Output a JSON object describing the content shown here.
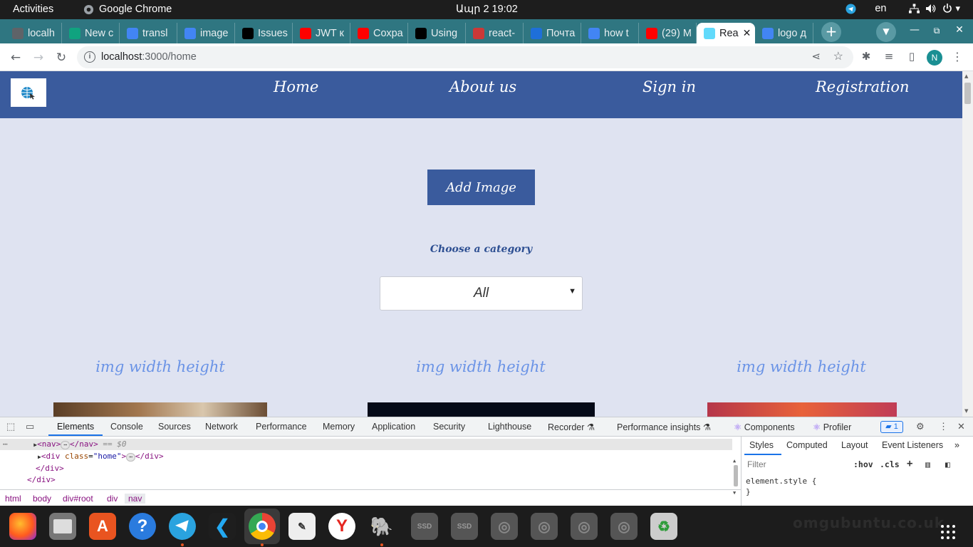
{
  "os_topbar": {
    "activities": "Activities",
    "app_name": "Google Chrome",
    "clock": "Ապր 2  19:02",
    "language": "en"
  },
  "browser": {
    "tabs": [
      {
        "label": "localh",
        "icon": "globe-icon",
        "color": "#5f6368"
      },
      {
        "label": "New c",
        "icon": "openai-icon",
        "color": "#10a37f"
      },
      {
        "label": "transl",
        "icon": "google-icon",
        "color": "#4285f4"
      },
      {
        "label": "image",
        "icon": "docs-icon",
        "color": "#4285f4"
      },
      {
        "label": "Issues",
        "icon": "github-icon",
        "color": "#000000"
      },
      {
        "label": "JWT к",
        "icon": "youtube-icon",
        "color": "#ff0000"
      },
      {
        "label": "Сохра",
        "icon": "youtube-icon",
        "color": "#ff0000"
      },
      {
        "label": "Using",
        "icon": "dev-icon",
        "color": "#000000"
      },
      {
        "label": "react-",
        "icon": "npm-icon",
        "color": "#cb3837"
      },
      {
        "label": "Почта",
        "icon": "mail-icon",
        "color": "#1e6fd9"
      },
      {
        "label": "how t",
        "icon": "google-icon",
        "color": "#4285f4"
      },
      {
        "label": "(29) M",
        "icon": "youtube-icon",
        "color": "#ff0000"
      },
      {
        "label": "Rea",
        "icon": "react-icon",
        "color": "#61dafb",
        "active": true
      },
      {
        "label": "logo д",
        "icon": "google-icon",
        "color": "#4285f4"
      }
    ],
    "url_host": "localhost",
    "url_path": ":3000/home",
    "profile_initial": "N"
  },
  "site": {
    "nav": {
      "links": [
        "Home",
        "About us",
        "Sign in",
        "Registration"
      ]
    },
    "add_button": "Add Image",
    "choose_label": "Choose a category",
    "category_select": {
      "selected": "All"
    },
    "image_titles": [
      "img width height",
      "img width height",
      "img width height"
    ]
  },
  "devtools": {
    "tabs": [
      "Elements",
      "Console",
      "Sources",
      "Network",
      "Performance",
      "Memory",
      "Application",
      "Security",
      "Lighthouse",
      "Recorder",
      "Performance insights",
      "Components",
      "Profiler"
    ],
    "issues_count": "1",
    "dom": {
      "line1_tag_open": "<nav>",
      "line1_tag_close": "</nav>",
      "line1_marker": "== $0",
      "line2_tag": "<div",
      "line2_attr": "class",
      "line2_val": "\"home\"",
      "line2_close": "</div>",
      "line3": "</div>",
      "line4": "</div>"
    },
    "breadcrumbs": [
      "html",
      "body",
      "div#root",
      "div",
      "nav"
    ],
    "styles_tabs": [
      "Styles",
      "Computed",
      "Layout",
      "Event Listeners"
    ],
    "filter_placeholder": "Filter",
    "hov": ":hov",
    "cls": ".cls",
    "element_style": "element.style {",
    "element_style_close": "}"
  },
  "dock": {
    "watermark": "omgubuntu.co.uk",
    "items": [
      "firefox",
      "files",
      "app-center",
      "help",
      "telegram",
      "vscode",
      "chrome",
      "inkscape",
      "yandex",
      "postgres",
      "ssd",
      "ssd",
      "disc",
      "disc",
      "disc",
      "disc",
      "trash"
    ]
  }
}
